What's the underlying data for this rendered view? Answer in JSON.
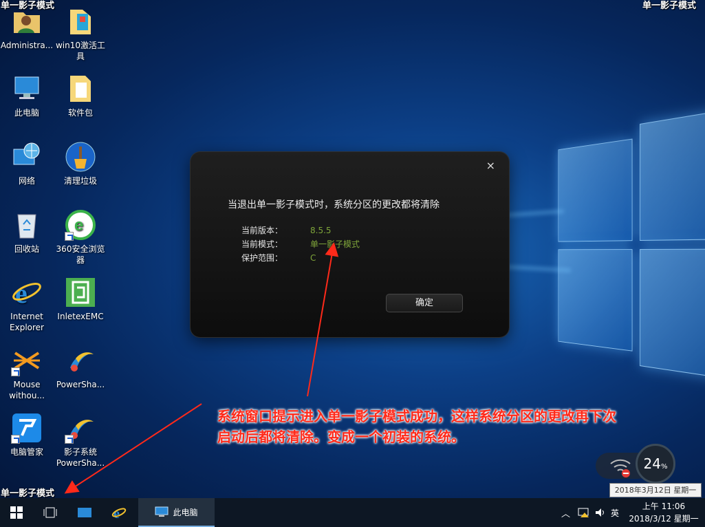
{
  "corner_labels": {
    "top_left": "单一影子模式",
    "top_right": "单一影子模式",
    "bottom_left": "单一影子模式"
  },
  "desktop_icons": [
    {
      "label": "Administra...",
      "icon": "user-folder-icon"
    },
    {
      "label": "win10激活工具",
      "icon": "folder-icon"
    },
    {
      "label": "此电脑",
      "icon": "computer-icon"
    },
    {
      "label": "软件包",
      "icon": "folder-icon"
    },
    {
      "label": "网络",
      "icon": "network-icon"
    },
    {
      "label": "清理垃圾",
      "icon": "broom-icon"
    },
    {
      "label": "回收站",
      "icon": "recycle-bin-icon"
    },
    {
      "label": "360安全浏览器",
      "icon": "360-browser-icon"
    },
    {
      "label": "Internet Explorer",
      "icon": "ie-icon"
    },
    {
      "label": "InletexEMC",
      "icon": "inletex-icon"
    },
    {
      "label": "Mouse withou...",
      "icon": "mouse-without-borders-icon"
    },
    {
      "label": "PowerSha...",
      "icon": "powershadow-icon"
    },
    {
      "label": "电脑管家",
      "icon": "pc-manager-icon"
    },
    {
      "label": "影子系统 PowerSha...",
      "icon": "powershadow-icon"
    }
  ],
  "dialog": {
    "message": "当退出单一影子模式时，系统分区的更改都将清除",
    "rows": [
      {
        "key": "当前版本：",
        "value": "8.5.5"
      },
      {
        "key": "当前模式：",
        "value": "单一影子模式"
      },
      {
        "key": "保护范围：",
        "value": "C"
      }
    ],
    "ok_label": "确定",
    "close_label": "×",
    "value_color": "#7fa53a"
  },
  "annotation": {
    "text_line1": "系统窗口提示进入单一影子模式成功，这样系统分区的更改再下次",
    "text_line2": "启动后都将清除。变成一个初装的系统。",
    "color": "#ff2a1a"
  },
  "net_widget": {
    "percent": "24",
    "unit": "%"
  },
  "date_tooltip": "2018年3月12日 星期一",
  "taskbar": {
    "active_window_label": "此电脑",
    "tray_ime": "英",
    "clock_time": "上午 11:06",
    "clock_date": "2018/3/12 星期一"
  }
}
